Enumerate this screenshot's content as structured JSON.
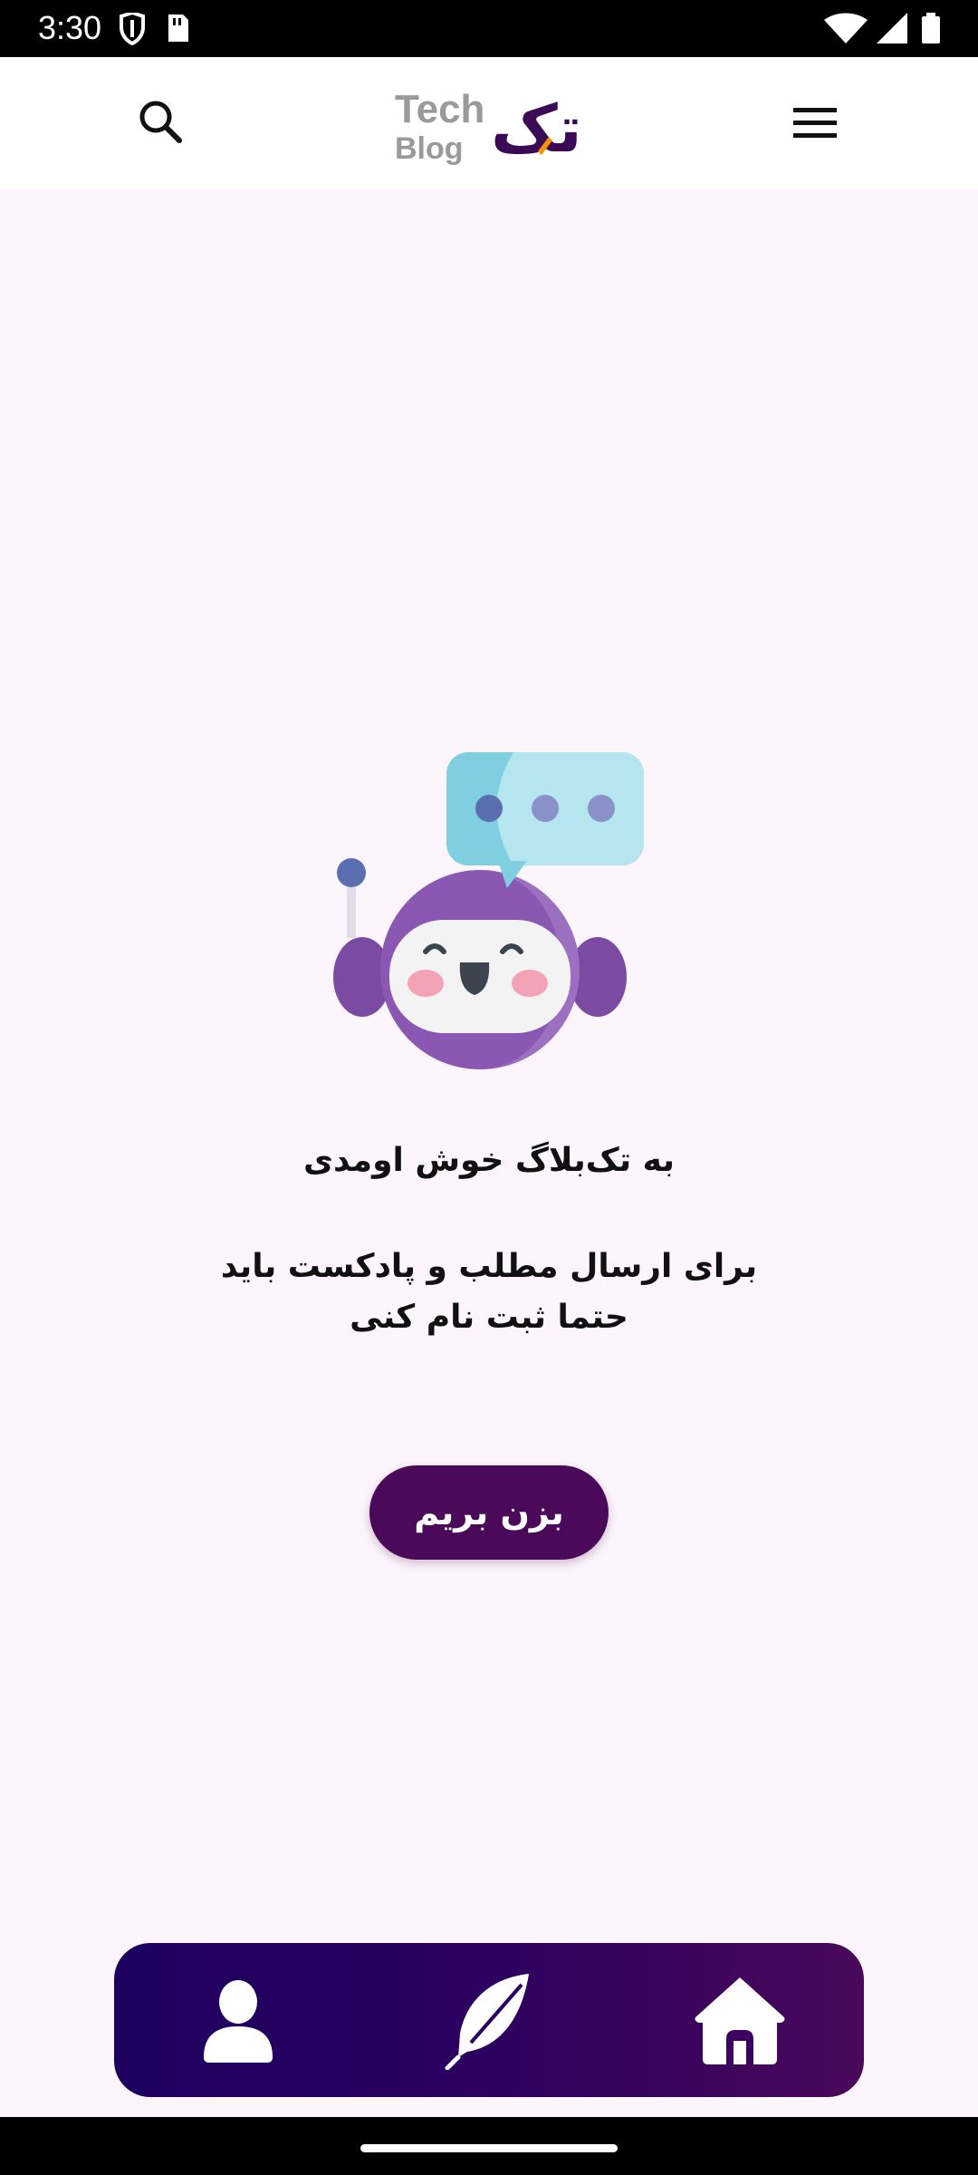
{
  "status_bar": {
    "time": "3:30",
    "icons": [
      "shield-icon",
      "sd-card-icon",
      "wifi-icon",
      "cellular-signal-icon",
      "battery-icon"
    ]
  },
  "app_bar": {
    "logo_latin_line1": "Tech",
    "logo_latin_line2": "Blog",
    "logo_persian": "تک",
    "search_icon": "search-icon",
    "menu_icon": "hamburger-menu-icon"
  },
  "main": {
    "illustration": "robot-with-chat-bubble",
    "welcome_title": "به تک‌بلاگ خوش اومدی",
    "welcome_description": "برای ارسال مطلب و پادکست باید حتما ثبت نام کنی",
    "cta_label": "بزن بریم"
  },
  "bottom_nav": {
    "items": [
      {
        "icon": "profile-icon"
      },
      {
        "icon": "feather-write-icon"
      },
      {
        "icon": "home-icon"
      }
    ]
  },
  "colors": {
    "background": "#fcf5fb",
    "primary": "#4b0a59",
    "nav_gradient_start": "#1d0060",
    "nav_gradient_end": "#4a085a",
    "logo_accent": "#f39200"
  }
}
